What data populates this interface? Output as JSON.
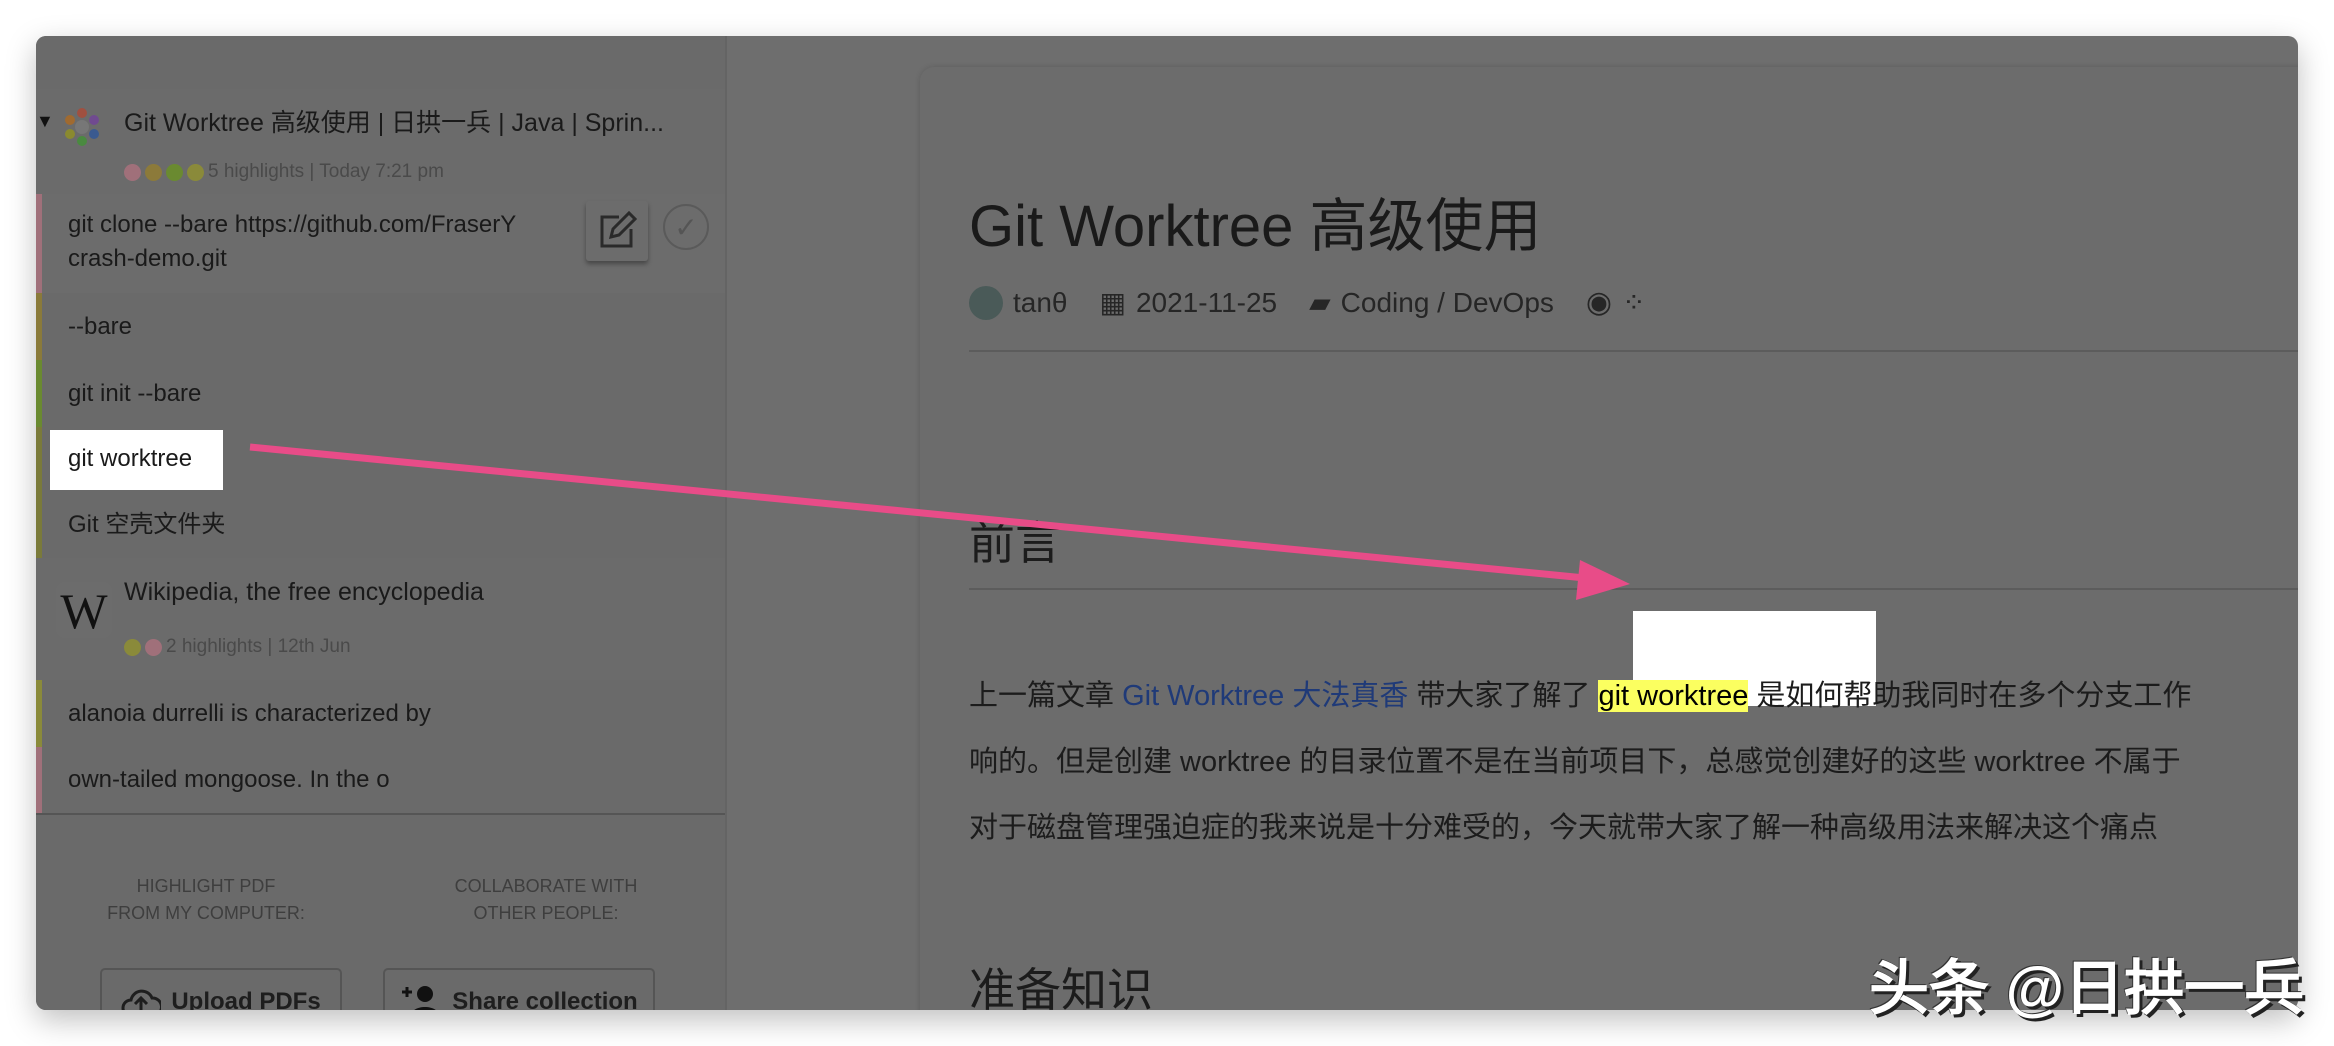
{
  "sidebar": {
    "groups": [
      {
        "title": "Git Worktree 高级使用 | 日拱一兵 | Java | Sprin...",
        "meta": "5 highlights | Today 7:21 pm",
        "dot_colors": [
          "#a0707a",
          "#8c7a3a",
          "#6a8a30",
          "#8a8a3a"
        ],
        "items": [
          {
            "text_line1": "git  clone  --bare  https://github.com/FraserY",
            "text_line2": "crash-demo.git",
            "color": "#a0707a"
          },
          {
            "text": "--bare",
            "color": "#8a7a3a"
          },
          {
            "text": "git init --bare",
            "color": "#6a8a30"
          },
          {
            "text": "git worktree",
            "color": "#7a7a3a"
          },
          {
            "text": "Git 空壳文件夹",
            "color": "#7a7a3a"
          }
        ]
      },
      {
        "title": "Wikipedia, the free encyclopedia",
        "logo_letter": "W",
        "meta": "2 highlights | 12th Jun",
        "dot_colors": [
          "#8a8a3a",
          "#a0707a"
        ],
        "items": [
          {
            "text": "alanoia durrelli is characterized by",
            "color": "#8a8a3a"
          },
          {
            "text": "own-tailed mongoose. In the o",
            "color": "#a0707a"
          }
        ]
      }
    ],
    "footer": {
      "pdf_label_1": "HIGHLIGHT PDF",
      "pdf_label_2": "FROM MY COMPUTER:",
      "collab_label_1": "COLLABORATE WITH",
      "collab_label_2": "OTHER PEOPLE:",
      "upload_button": "Upload PDFs",
      "share_button": "Share collection"
    }
  },
  "article": {
    "title": "Git Worktree 高级使用",
    "author": "tanθ",
    "date": "2021-11-25",
    "category": "Coding / DevOps",
    "section1": "前言",
    "para_1a": "上一篇文章 ",
    "para_link": "Git Worktree 大法真香",
    "para_1b": " 带大家了解了 ",
    "para_mark": "git worktree",
    "para_1c": " 是如何帮助我同时在多个分支工作",
    "para_2": "响的。但是创建 worktree 的目录位置不是在当前项目下，总感觉创建好的这些 worktree 不属于",
    "para_3": "对于磁盘管理强迫症的我来说是十分难受的，今天就带大家了解一种高级用法来解决这个痛点",
    "section2": "准备知识"
  },
  "watermark": "头条 @日拱一兵",
  "colors": {
    "arrow": "#e84c88",
    "highlight": "#fbff60",
    "link": "#1f3a78"
  }
}
